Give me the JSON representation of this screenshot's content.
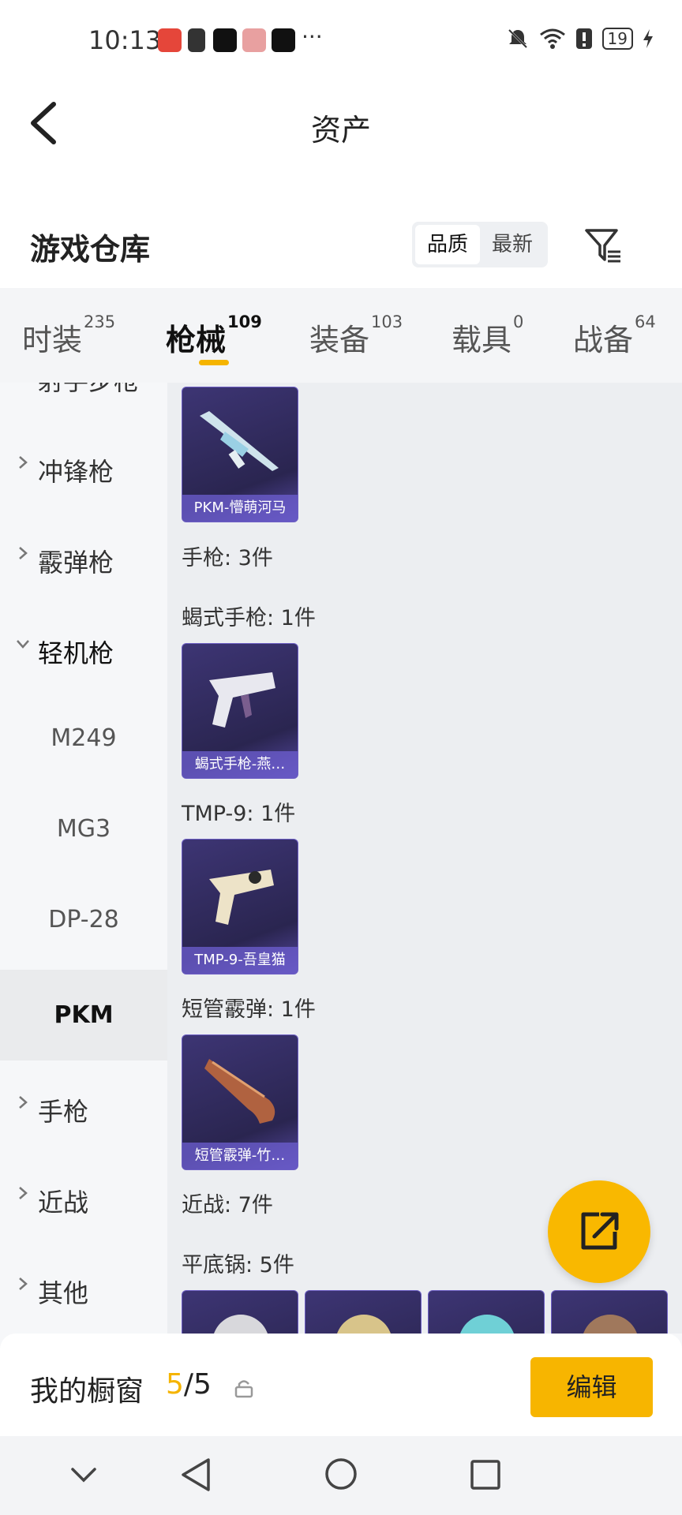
{
  "status": {
    "time": "10:13",
    "battery": "19"
  },
  "header": {
    "title": "资产"
  },
  "subheader": {
    "title": "游戏仓库",
    "sort": [
      "品质",
      "最新"
    ]
  },
  "tabs": [
    {
      "label": "时装",
      "count": "235"
    },
    {
      "label": "枪械",
      "count": "109"
    },
    {
      "label": "装备",
      "count": "103"
    },
    {
      "label": "载具",
      "count": "0"
    },
    {
      "label": "战备",
      "count": "64"
    }
  ],
  "sidebar": {
    "items": [
      "射手步枪",
      "冲锋枪",
      "霰弹枪",
      "轻机枪",
      "M249",
      "MG3",
      "DP-28",
      "PKM",
      "手枪",
      "近战",
      "其他"
    ]
  },
  "content": {
    "card_pkm": "PKM-懵萌河马",
    "label_pistol": "手枪: 3件",
    "label_scorpion": "蝎式手枪: 1件",
    "card_scorpion": "蝎式手枪-燕…",
    "label_tmp": "TMP-9: 1件",
    "card_tmp": "TMP-9-吾皇猫",
    "label_shotgun": "短管霰弹: 1件",
    "card_shotgun": "短管霰弹-竹…",
    "label_melee": "近战: 7件",
    "label_pan": "平底锅: 5件"
  },
  "bottom": {
    "title": "我的橱窗",
    "count_current": "5",
    "count_total": "/5",
    "edit_label": "编辑"
  },
  "colors": {
    "accent": "#f7b500",
    "card": "#2f2a5c"
  }
}
